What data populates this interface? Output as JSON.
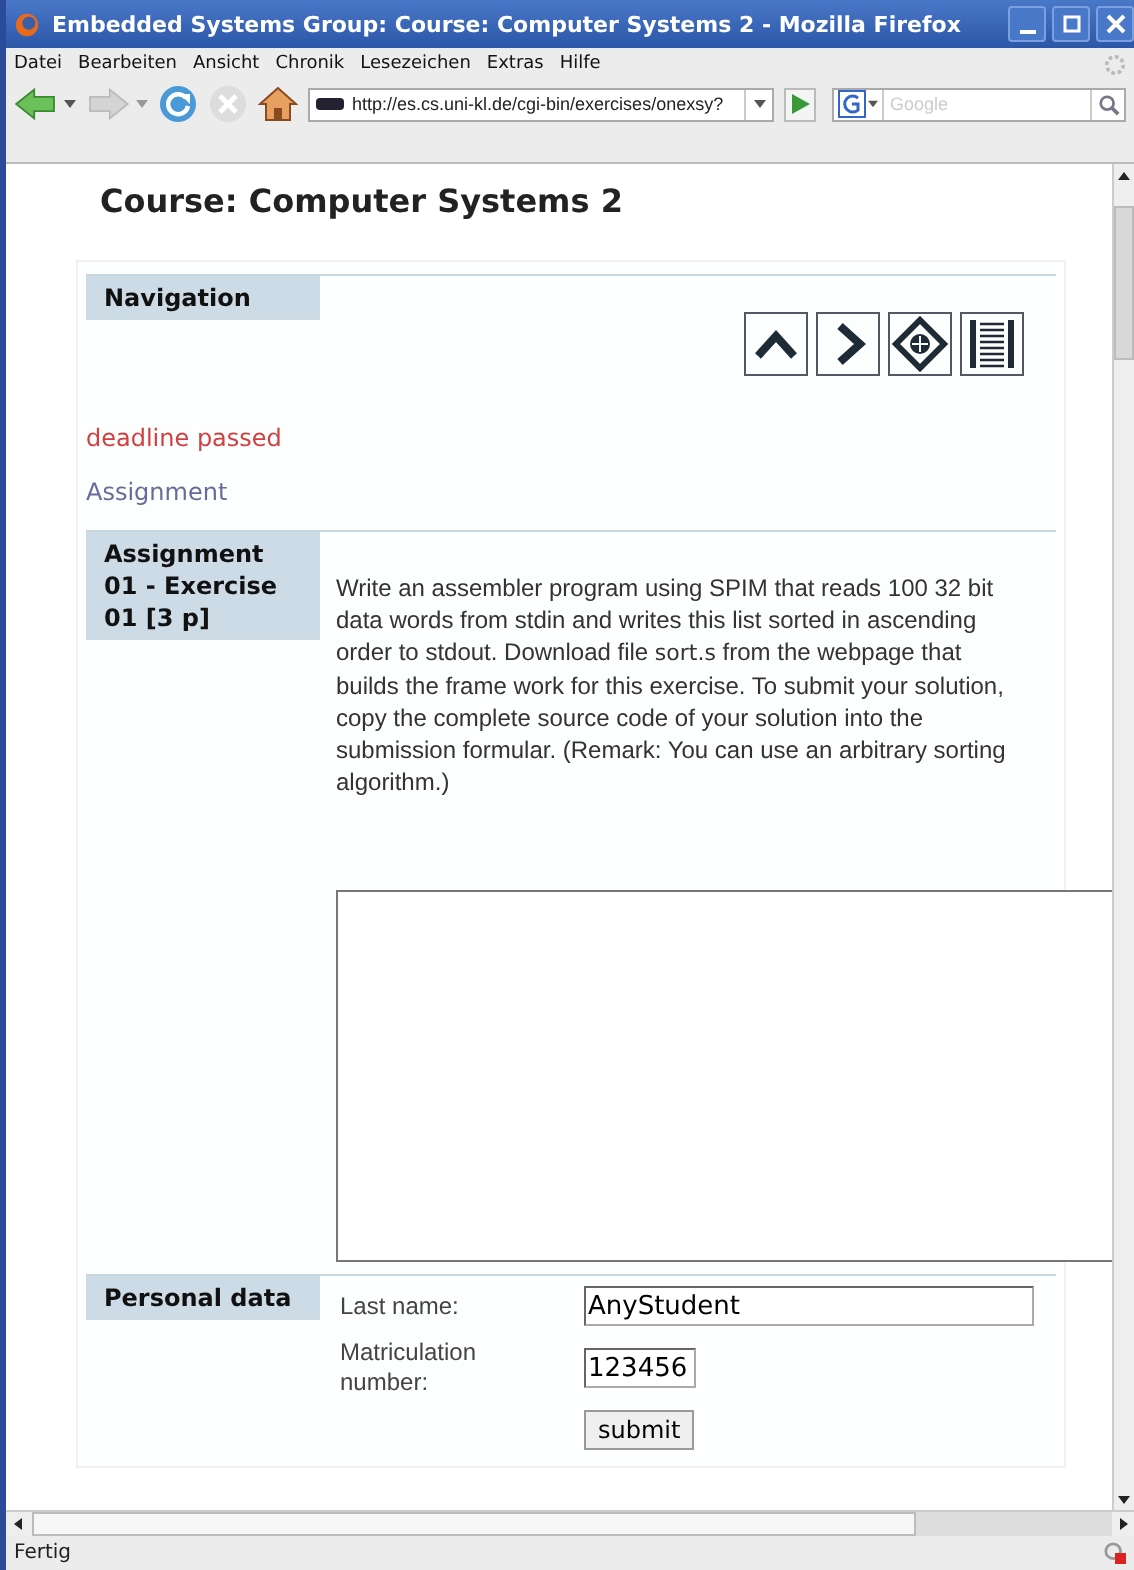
{
  "window": {
    "title": "Embedded Systems Group: Course: Computer Systems 2 - Mozilla Firefox"
  },
  "menu": [
    "Datei",
    "Bearbeiten",
    "Ansicht",
    "Chronik",
    "Lesezeichen",
    "Extras",
    "Hilfe"
  ],
  "address_bar": {
    "value": "http://es.cs.uni-kl.de/cgi-bin/exercises/onexsy?"
  },
  "search": {
    "placeholder": "Google"
  },
  "page": {
    "heading": "Course: Computer Systems 2",
    "navigation": {
      "label": "Navigation",
      "buttons": [
        {
          "kind": "up"
        },
        {
          "kind": "next"
        },
        {
          "kind": "home"
        },
        {
          "kind": "list"
        }
      ]
    },
    "deadline": "deadline passed",
    "section_link": "Assignment",
    "assignment": {
      "label": "Assignment 01 - Exercise 01 [3 p]",
      "description": [
        {
          "text": "Write an assembler program using SPIM that reads 100 32 bit data words from stdin and writes this list sorted in ascending order to stdout. Download file ",
          "code": false
        },
        {
          "text": "sort.s",
          "code": true
        },
        {
          "text": " from the webpage that builds the frame work for this exercise. To submit your solution, copy the complete source code of your solution into the submission formular. (Remark: You can use an arbitrary sorting algorithm.)",
          "code": false
        }
      ]
    },
    "personal": {
      "label": "Personal data",
      "fields": [
        {
          "label": "Last name:",
          "value": "AnyStudent",
          "wide": true
        },
        {
          "label": "Matriculation number:",
          "value": "123456",
          "wide": false
        }
      ],
      "submit": "submit"
    }
  },
  "status_bar": "Fertig"
}
